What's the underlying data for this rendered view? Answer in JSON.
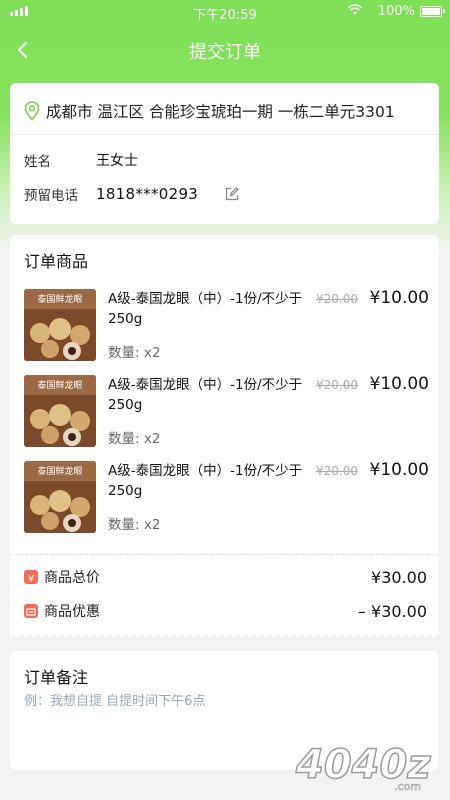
{
  "status_bar": {
    "time": "下午20:59",
    "battery": "100%"
  },
  "nav": {
    "title": "提交订单"
  },
  "address": {
    "text": "成都市 温江区 合能珍宝琥珀一期   一栋二单元3301",
    "name_label": "姓名",
    "name": "王女士",
    "phone_label": "预留电话",
    "phone": "1818***0293"
  },
  "goods": {
    "title": "订单商品",
    "items": [
      {
        "thumb_text": "泰国鲜龙眼",
        "name": "A级-泰国龙眼（中）-1份/不少于250g",
        "orig_price": "¥20.00",
        "price": "¥10.00",
        "qty": "数量:   x2"
      },
      {
        "thumb_text": "泰国鲜龙眼",
        "name": "A级-泰国龙眼（中）-1份/不少于250g",
        "orig_price": "¥20.00",
        "price": "¥10.00",
        "qty": "数量:   x2"
      },
      {
        "thumb_text": "泰国鲜龙眼",
        "name": "A级-泰国龙眼（中）-1份/不少于250g",
        "orig_price": "¥20.00",
        "price": "¥10.00",
        "qty": "数量:   x2"
      }
    ]
  },
  "summary": {
    "total_label": "商品总价",
    "total": "¥30.00",
    "discount_label": "商品优惠",
    "discount": "– ¥30.00",
    "total_icon_color": "#f06a5a",
    "discount_icon_color": "#f06a5a"
  },
  "note": {
    "title": "订单备注",
    "placeholder": "例：我想自提 自提时间下午6点"
  },
  "watermark": {
    "text": "4040z.com"
  },
  "colors": {
    "brand_green": "#7ddf55"
  }
}
